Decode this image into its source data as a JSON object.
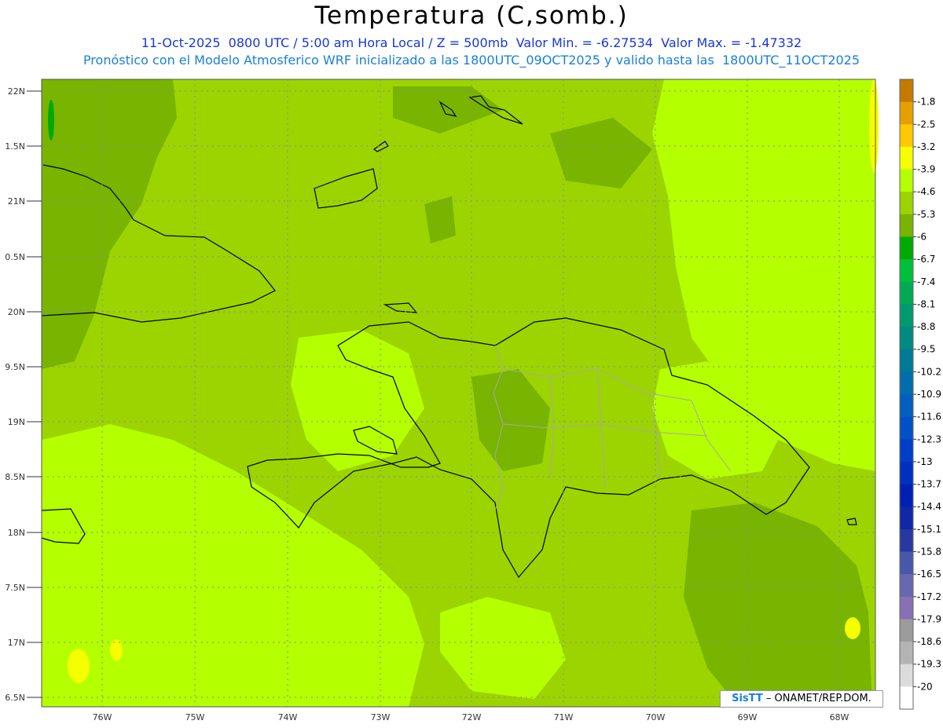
{
  "header": {
    "title": "Temperatura (C,somb.)",
    "line1": "11-Oct-2025  0800 UTC / 5:00 am Hora Local / Z = 500mb  Valor Min. = -6.27534  Valor Max. = -1.47332",
    "line2": "Pronóstico con el Modelo Atmosferico WRF inicializado a las 1800UTC_09OCT2025 y valido hasta las  1800UTC_11OCT2025"
  },
  "map": {
    "lat_labels": [
      "22N",
      "1.5N",
      "21N",
      "0.5N",
      "20N",
      "9.5N",
      "19N",
      "8.5N",
      "18N",
      "7.5N",
      "17N",
      "6.5N"
    ],
    "lon_labels": [
      "76W",
      "75W",
      "74W",
      "73W",
      "72W",
      "71W",
      "70W",
      "69W",
      "68W"
    ]
  },
  "colorbar": {
    "labels": [
      "-1.8",
      "-2.5",
      "-3.2",
      "-3.9",
      "-4.6",
      "-5.3",
      "-6",
      "-6.7",
      "-7.4",
      "-8.1",
      "-8.8",
      "-9.5",
      "-10.2",
      "-10.9",
      "-11.6",
      "-12.3",
      "-13",
      "-13.7",
      "-14.4",
      "-15.1",
      "-15.8",
      "-16.5",
      "-17.2",
      "-17.9",
      "-18.6",
      "-19.3",
      "-20"
    ],
    "colors": [
      "#c47a00",
      "#e69f00",
      "#ffc800",
      "#f5ff00",
      "#b4ff00",
      "#9bd400",
      "#78b400",
      "#00aa00",
      "#00bf3a",
      "#00aa55",
      "#009a6e",
      "#008a82",
      "#007a96",
      "#006eaa",
      "#005fbf",
      "#0050c8",
      "#0040c8",
      "#0030c0",
      "#0020b4",
      "#1028a8",
      "#2838a0",
      "#4858a8",
      "#6868b0",
      "#8870b4",
      "#9c9c9c",
      "#b4b4b4",
      "#dcdcdc",
      "#ffffff"
    ]
  },
  "credit": {
    "logo": "SisTT",
    "text": "– ONAMET/REP.DOM."
  }
}
